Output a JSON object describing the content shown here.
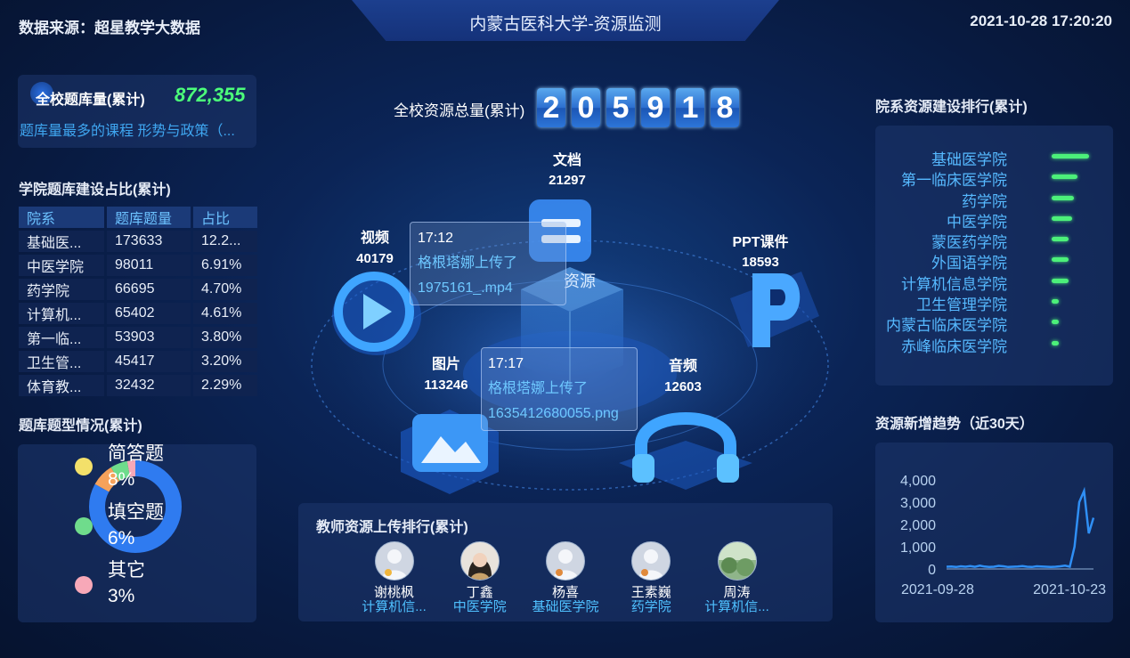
{
  "header": {
    "source": "数据来源：超星教学大数据",
    "title": "内蒙古医科大学-资源监测",
    "datetime": "2021-10-28 17:20:20"
  },
  "question_bank": {
    "label": "全校题库量(累计)",
    "value": "872,355",
    "top_course": "题库量最多的课程 形势与政策（..."
  },
  "college_share": {
    "title": "学院题库建设占比(累计)",
    "headers": [
      "院系",
      "题库题量",
      "占比"
    ],
    "rows": [
      [
        "基础医...",
        "173633",
        "12.2..."
      ],
      [
        "中医学院",
        "98011",
        "6.91%"
      ],
      [
        "药学院",
        "66695",
        "4.70%"
      ],
      [
        "计算机...",
        "65402",
        "4.61%"
      ],
      [
        "第一临...",
        "53903",
        "3.80%"
      ],
      [
        "卫生管...",
        "45417",
        "3.20%"
      ],
      [
        "体育教...",
        "32432",
        "2.29%"
      ]
    ]
  },
  "question_types": {
    "title": "题库题型情况(累计)",
    "legend": [
      {
        "name": "简答题",
        "pct": "8%",
        "color": "#f3e06a"
      },
      {
        "name": "填空题",
        "pct": "6%",
        "color": "#6fdc8c"
      },
      {
        "name": "其它",
        "pct": "3%",
        "color": "#f7a8b8"
      }
    ],
    "donut": [
      {
        "value": 83,
        "color": "#2f7bf0"
      },
      {
        "value": 8,
        "color": "#f6a25b"
      },
      {
        "value": 6,
        "color": "#6fdc8c"
      },
      {
        "value": 3,
        "color": "#f7a8b8"
      }
    ]
  },
  "resources": {
    "total_label": "全校资源总量(累计)",
    "digits": [
      "2",
      "0",
      "5",
      "9",
      "1",
      "8"
    ],
    "center_label": "资源",
    "categories": {
      "doc": {
        "name": "文档",
        "value": "21297"
      },
      "video": {
        "name": "视频",
        "value": "40179"
      },
      "ppt": {
        "name": "PPT课件",
        "value": "18593"
      },
      "image": {
        "name": "图片",
        "value": "113246"
      },
      "audio": {
        "name": "音频",
        "value": "12603"
      }
    },
    "popups": [
      {
        "time": "17:12",
        "text": "格根塔娜上传了",
        "file": "1975161_.mp4"
      },
      {
        "time": "17:17",
        "text": "格根塔娜上传了",
        "file": "1635412680055.png"
      }
    ]
  },
  "teachers": {
    "title": "教师资源上传排行(累计)",
    "list": [
      {
        "name": "谢桃枫",
        "dept": "计算机信..."
      },
      {
        "name": "丁鑫",
        "dept": "中医学院"
      },
      {
        "name": "杨喜",
        "dept": "基础医学院"
      },
      {
        "name": "王素巍",
        "dept": "药学院"
      },
      {
        "name": "周涛",
        "dept": "计算机信..."
      }
    ]
  },
  "dept_ranking": {
    "title": "院系资源建设排行(累计)",
    "items": [
      {
        "name": "基础医学院",
        "level": 1.0
      },
      {
        "name": "第一临床医学院",
        "level": 0.7
      },
      {
        "name": "药学院",
        "level": 0.6
      },
      {
        "name": "中医学院",
        "level": 0.55
      },
      {
        "name": "蒙医药学院",
        "level": 0.45
      },
      {
        "name": "外国语学院",
        "level": 0.45
      },
      {
        "name": "计算机信息学院",
        "level": 0.45
      },
      {
        "name": "卫生管理学院",
        "level": 0.2
      },
      {
        "name": "内蒙古临床医学院",
        "level": 0.2
      },
      {
        "name": "赤峰临床医学院",
        "level": 0.2
      }
    ]
  },
  "trend": {
    "title": "资源新增趋势（近30天）",
    "chart_data": {
      "type": "line",
      "x_start": "2021-09-28",
      "x_end": "2021-10-23",
      "xticks": [
        "2021-09-28",
        "2021-10-23"
      ],
      "yticks": [
        "4,000",
        "3,000",
        "2,000",
        "1,000",
        "0"
      ],
      "ylim": [
        0,
        4000
      ],
      "series": [
        {
          "values": [
            100,
            110,
            90,
            120,
            100,
            130,
            95,
            150,
            110,
            90,
            100,
            140,
            120,
            90,
            100,
            110,
            130,
            100,
            90,
            120,
            110,
            100,
            90,
            100,
            120,
            150,
            100,
            1000,
            3000,
            3500,
            1600,
            2300
          ]
        }
      ]
    }
  }
}
